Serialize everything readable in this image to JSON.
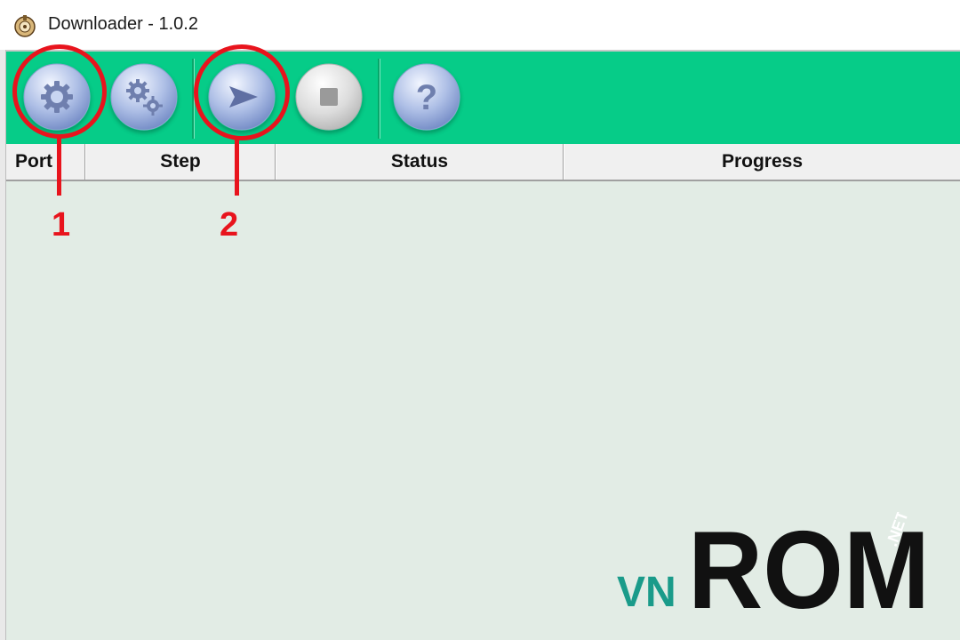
{
  "window": {
    "title": "Downloader - 1.0.2",
    "app_icon": "downloader-app-icon"
  },
  "toolbar": {
    "buttons": [
      {
        "name": "settings-button",
        "icon": "gear-icon"
      },
      {
        "name": "advanced-settings-button",
        "icon": "gears-icon"
      },
      {
        "name": "start-button",
        "icon": "play-arrow-icon"
      },
      {
        "name": "stop-button",
        "icon": "stop-icon"
      },
      {
        "name": "help-button",
        "icon": "help-question-icon"
      }
    ],
    "background_color": "#06cc88"
  },
  "table": {
    "columns": [
      "Port",
      "Step",
      "Status",
      "Progress"
    ],
    "rows": []
  },
  "annotations": [
    {
      "label": "1",
      "target": "settings-button"
    },
    {
      "label": "2",
      "target": "start-button"
    }
  ],
  "watermark": {
    "text_left": "VN",
    "text_main": "ROM",
    "text_small": ".NET",
    "color_left": "#1a9b8a",
    "color_main": "#111111"
  },
  "colors": {
    "content_background": "#e2ece5",
    "annotation_red": "#e8141d"
  }
}
